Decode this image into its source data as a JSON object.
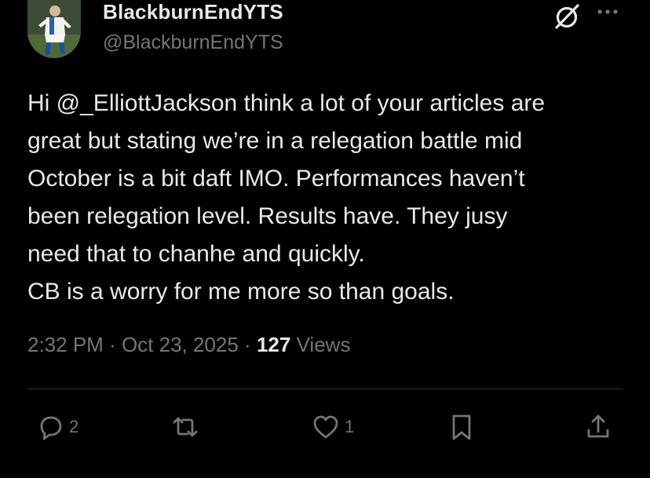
{
  "author": {
    "display_name": "BlackburnEndYTS",
    "handle": "@BlackburnEndYTS"
  },
  "tweet": {
    "lines": [
      "Hi @_ElliottJackson think a lot of your articles are",
      "great but stating we’re in a relegation battle mid",
      "October is a bit daft IMO. Performances haven’t",
      "been relegation level. Results have. They jusy",
      "need that to chanhe and quickly.",
      "CB is a worry for me more so than goals."
    ]
  },
  "meta": {
    "time": "2:32 PM",
    "separator": " · ",
    "date": "Oct 23, 2025",
    "views_count": "127",
    "views_label": "Views"
  },
  "actions": {
    "reply_count": "2",
    "retweet_count": "",
    "like_count": "1"
  },
  "icons": {
    "grok": "grok-icon",
    "more": "more-icon",
    "reply": "reply-icon",
    "retweet": "retweet-icon",
    "like": "heart-icon",
    "bookmark": "bookmark-icon",
    "share": "share-icon"
  },
  "colors": {
    "background": "#000000",
    "primary_text": "#e7e9ea",
    "secondary_text": "#71767b",
    "divider": "#2f3336"
  }
}
